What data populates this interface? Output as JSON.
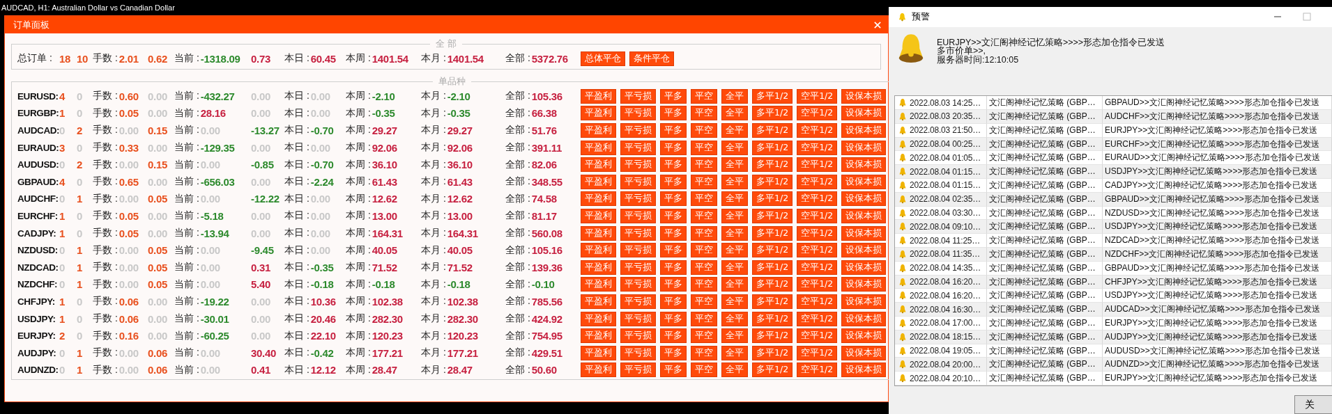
{
  "chart": {
    "title": "AUDCAD, H1:  Australian Dollar vs Canadian Dollar"
  },
  "order_panel": {
    "title": "订单面板",
    "summary": {
      "legend": "全 部",
      "label": "总订单 :",
      "cells": [
        {
          "text": "18",
          "color": "#e8501e"
        },
        {
          "text": "10",
          "color": "#e8501e"
        },
        {
          "label": "手数 :",
          "text": "2.01",
          "color": "#e8501e"
        },
        {
          "text": "0.62",
          "color": "#e8501e"
        },
        {
          "label": "当前 :",
          "text": "-1318.09",
          "color": "#2d8a2d"
        },
        {
          "text": "0.73",
          "color": "#c61f3f"
        },
        {
          "label": "本日 :",
          "text": "60.45",
          "color": "#c61f3f"
        },
        {
          "label": "本周 :",
          "text": "1401.54",
          "color": "#c61f3f"
        },
        {
          "label": "本月 :",
          "text": "1401.54",
          "color": "#c61f3f"
        },
        {
          "label": "全部 :",
          "text": "5372.76",
          "color": "#c61f3f"
        }
      ],
      "buttons": [
        "总体平仓",
        "条件平仓"
      ]
    },
    "symbols": {
      "legend": "单品种",
      "rows": [
        {
          "pair": "EURUSD:",
          "cells": [
            {
              "text": "4",
              "color": "#e8501e"
            },
            {
              "text": "0",
              "color": "#c8c8c8"
            },
            {
              "label": "手数 :",
              "text": "0.60",
              "color": "#e8501e"
            },
            {
              "text": "0.00",
              "color": "#c8c8c8"
            },
            {
              "label": "当前 :",
              "text": "-432.27",
              "color": "#2d8a2d"
            },
            {
              "text": "0.00",
              "color": "#c8c8c8"
            },
            {
              "label": "本日 :",
              "text": "0.00",
              "color": "#c8c8c8"
            },
            {
              "label": "本周 :",
              "text": "-2.10",
              "color": "#2d8a2d"
            },
            {
              "label": "本月 :",
              "text": "-2.10",
              "color": "#2d8a2d"
            },
            {
              "label": "全部 :",
              "text": "105.36",
              "color": "#c61f3f"
            }
          ],
          "buttons": [
            "平盈利",
            "平亏损",
            "平多",
            "平空",
            "全平",
            "多平1/2",
            "空平1/2",
            "设保本损"
          ]
        },
        {
          "pair": "EURGBP:",
          "cells": [
            {
              "text": "1",
              "color": "#e8501e"
            },
            {
              "text": "0",
              "color": "#c8c8c8"
            },
            {
              "label": "手数 :",
              "text": "0.05",
              "color": "#e8501e"
            },
            {
              "text": "0.00",
              "color": "#c8c8c8"
            },
            {
              "label": "当前 :",
              "text": "28.16",
              "color": "#c61f3f"
            },
            {
              "text": "0.00",
              "color": "#c8c8c8"
            },
            {
              "label": "本日 :",
              "text": "0.00",
              "color": "#c8c8c8"
            },
            {
              "label": "本周 :",
              "text": "-0.35",
              "color": "#2d8a2d"
            },
            {
              "label": "本月 :",
              "text": "-0.35",
              "color": "#2d8a2d"
            },
            {
              "label": "全部 :",
              "text": "66.38",
              "color": "#c61f3f"
            }
          ],
          "buttons": [
            "平盈利",
            "平亏损",
            "平多",
            "平空",
            "全平",
            "多平1/2",
            "空平1/2",
            "设保本损"
          ]
        },
        {
          "pair": "AUDCAD:",
          "cells": [
            {
              "text": "0",
              "color": "#c8c8c8"
            },
            {
              "text": "2",
              "color": "#e8501e"
            },
            {
              "label": "手数 :",
              "text": "0.00",
              "color": "#c8c8c8"
            },
            {
              "text": "0.15",
              "color": "#e8501e"
            },
            {
              "label": "当前 :",
              "text": "0.00",
              "color": "#c8c8c8"
            },
            {
              "text": "-13.27",
              "color": "#2d8a2d"
            },
            {
              "label": "本日 :",
              "text": "-0.70",
              "color": "#2d8a2d"
            },
            {
              "label": "本周 :",
              "text": "29.27",
              "color": "#c61f3f"
            },
            {
              "label": "本月 :",
              "text": "29.27",
              "color": "#c61f3f"
            },
            {
              "label": "全部 :",
              "text": "51.76",
              "color": "#c61f3f"
            }
          ],
          "buttons": [
            "平盈利",
            "平亏损",
            "平多",
            "平空",
            "全平",
            "多平1/2",
            "空平1/2",
            "设保本损"
          ]
        },
        {
          "pair": "EURAUD:",
          "cells": [
            {
              "text": "3",
              "color": "#e8501e"
            },
            {
              "text": "0",
              "color": "#c8c8c8"
            },
            {
              "label": "手数 :",
              "text": "0.33",
              "color": "#e8501e"
            },
            {
              "text": "0.00",
              "color": "#c8c8c8"
            },
            {
              "label": "当前 :",
              "text": "-129.35",
              "color": "#2d8a2d"
            },
            {
              "text": "0.00",
              "color": "#c8c8c8"
            },
            {
              "label": "本日 :",
              "text": "0.00",
              "color": "#c8c8c8"
            },
            {
              "label": "本周 :",
              "text": "92.06",
              "color": "#c61f3f"
            },
            {
              "label": "本月 :",
              "text": "92.06",
              "color": "#c61f3f"
            },
            {
              "label": "全部 :",
              "text": "391.11",
              "color": "#c61f3f"
            }
          ],
          "buttons": [
            "平盈利",
            "平亏损",
            "平多",
            "平空",
            "全平",
            "多平1/2",
            "空平1/2",
            "设保本损"
          ]
        },
        {
          "pair": "AUDUSD:",
          "cells": [
            {
              "text": "0",
              "color": "#c8c8c8"
            },
            {
              "text": "2",
              "color": "#e8501e"
            },
            {
              "label": "手数 :",
              "text": "0.00",
              "color": "#c8c8c8"
            },
            {
              "text": "0.15",
              "color": "#e8501e"
            },
            {
              "label": "当前 :",
              "text": "0.00",
              "color": "#c8c8c8"
            },
            {
              "text": "-0.85",
              "color": "#2d8a2d"
            },
            {
              "label": "本日 :",
              "text": "-0.70",
              "color": "#2d8a2d"
            },
            {
              "label": "本周 :",
              "text": "36.10",
              "color": "#c61f3f"
            },
            {
              "label": "本月 :",
              "text": "36.10",
              "color": "#c61f3f"
            },
            {
              "label": "全部 :",
              "text": "82.06",
              "color": "#c61f3f"
            }
          ],
          "buttons": [
            "平盈利",
            "平亏损",
            "平多",
            "平空",
            "全平",
            "多平1/2",
            "空平1/2",
            "设保本损"
          ]
        },
        {
          "pair": "GBPAUD:",
          "cells": [
            {
              "text": "4",
              "color": "#e8501e"
            },
            {
              "text": "0",
              "color": "#c8c8c8"
            },
            {
              "label": "手数 :",
              "text": "0.65",
              "color": "#e8501e"
            },
            {
              "text": "0.00",
              "color": "#c8c8c8"
            },
            {
              "label": "当前 :",
              "text": "-656.03",
              "color": "#2d8a2d"
            },
            {
              "text": "0.00",
              "color": "#c8c8c8"
            },
            {
              "label": "本日 :",
              "text": "-2.24",
              "color": "#2d8a2d"
            },
            {
              "label": "本周 :",
              "text": "61.43",
              "color": "#c61f3f"
            },
            {
              "label": "本月 :",
              "text": "61.43",
              "color": "#c61f3f"
            },
            {
              "label": "全部 :",
              "text": "348.55",
              "color": "#c61f3f"
            }
          ],
          "buttons": [
            "平盈利",
            "平亏损",
            "平多",
            "平空",
            "全平",
            "多平1/2",
            "空平1/2",
            "设保本损"
          ]
        },
        {
          "pair": "AUDCHF:",
          "cells": [
            {
              "text": "0",
              "color": "#c8c8c8"
            },
            {
              "text": "1",
              "color": "#e8501e"
            },
            {
              "label": "手数 :",
              "text": "0.00",
              "color": "#c8c8c8"
            },
            {
              "text": "0.05",
              "color": "#e8501e"
            },
            {
              "label": "当前 :",
              "text": "0.00",
              "color": "#c8c8c8"
            },
            {
              "text": "-12.22",
              "color": "#2d8a2d"
            },
            {
              "label": "本日 :",
              "text": "0.00",
              "color": "#c8c8c8"
            },
            {
              "label": "本周 :",
              "text": "12.62",
              "color": "#c61f3f"
            },
            {
              "label": "本月 :",
              "text": "12.62",
              "color": "#c61f3f"
            },
            {
              "label": "全部 :",
              "text": "74.58",
              "color": "#c61f3f"
            }
          ],
          "buttons": [
            "平盈利",
            "平亏损",
            "平多",
            "平空",
            "全平",
            "多平1/2",
            "空平1/2",
            "设保本损"
          ]
        },
        {
          "pair": "EURCHF:",
          "cells": [
            {
              "text": "1",
              "color": "#e8501e"
            },
            {
              "text": "0",
              "color": "#c8c8c8"
            },
            {
              "label": "手数 :",
              "text": "0.05",
              "color": "#e8501e"
            },
            {
              "text": "0.00",
              "color": "#c8c8c8"
            },
            {
              "label": "当前 :",
              "text": "-5.18",
              "color": "#2d8a2d"
            },
            {
              "text": "0.00",
              "color": "#c8c8c8"
            },
            {
              "label": "本日 :",
              "text": "0.00",
              "color": "#c8c8c8"
            },
            {
              "label": "本周 :",
              "text": "13.00",
              "color": "#c61f3f"
            },
            {
              "label": "本月 :",
              "text": "13.00",
              "color": "#c61f3f"
            },
            {
              "label": "全部 :",
              "text": "81.17",
              "color": "#c61f3f"
            }
          ],
          "buttons": [
            "平盈利",
            "平亏损",
            "平多",
            "平空",
            "全平",
            "多平1/2",
            "空平1/2",
            "设保本损"
          ]
        },
        {
          "pair": "CADJPY:",
          "cells": [
            {
              "text": "1",
              "color": "#e8501e"
            },
            {
              "text": "0",
              "color": "#c8c8c8"
            },
            {
              "label": "手数 :",
              "text": "0.05",
              "color": "#e8501e"
            },
            {
              "text": "0.00",
              "color": "#c8c8c8"
            },
            {
              "label": "当前 :",
              "text": "-13.94",
              "color": "#2d8a2d"
            },
            {
              "text": "0.00",
              "color": "#c8c8c8"
            },
            {
              "label": "本日 :",
              "text": "0.00",
              "color": "#c8c8c8"
            },
            {
              "label": "本周 :",
              "text": "164.31",
              "color": "#c61f3f"
            },
            {
              "label": "本月 :",
              "text": "164.31",
              "color": "#c61f3f"
            },
            {
              "label": "全部 :",
              "text": "560.08",
              "color": "#c61f3f"
            }
          ],
          "buttons": [
            "平盈利",
            "平亏损",
            "平多",
            "平空",
            "全平",
            "多平1/2",
            "空平1/2",
            "设保本损"
          ]
        },
        {
          "pair": "NZDUSD:",
          "cells": [
            {
              "text": "0",
              "color": "#c8c8c8"
            },
            {
              "text": "1",
              "color": "#e8501e"
            },
            {
              "label": "手数 :",
              "text": "0.00",
              "color": "#c8c8c8"
            },
            {
              "text": "0.05",
              "color": "#e8501e"
            },
            {
              "label": "当前 :",
              "text": "0.00",
              "color": "#c8c8c8"
            },
            {
              "text": "-9.45",
              "color": "#2d8a2d"
            },
            {
              "label": "本日 :",
              "text": "0.00",
              "color": "#c8c8c8"
            },
            {
              "label": "本周 :",
              "text": "40.05",
              "color": "#c61f3f"
            },
            {
              "label": "本月 :",
              "text": "40.05",
              "color": "#c61f3f"
            },
            {
              "label": "全部 :",
              "text": "105.16",
              "color": "#c61f3f"
            }
          ],
          "buttons": [
            "平盈利",
            "平亏损",
            "平多",
            "平空",
            "全平",
            "多平1/2",
            "空平1/2",
            "设保本损"
          ]
        },
        {
          "pair": "NZDCAD:",
          "cells": [
            {
              "text": "0",
              "color": "#c8c8c8"
            },
            {
              "text": "1",
              "color": "#e8501e"
            },
            {
              "label": "手数 :",
              "text": "0.00",
              "color": "#c8c8c8"
            },
            {
              "text": "0.05",
              "color": "#e8501e"
            },
            {
              "label": "当前 :",
              "text": "0.00",
              "color": "#c8c8c8"
            },
            {
              "text": "0.31",
              "color": "#c61f3f"
            },
            {
              "label": "本日 :",
              "text": "-0.35",
              "color": "#2d8a2d"
            },
            {
              "label": "本周 :",
              "text": "71.52",
              "color": "#c61f3f"
            },
            {
              "label": "本月 :",
              "text": "71.52",
              "color": "#c61f3f"
            },
            {
              "label": "全部 :",
              "text": "139.36",
              "color": "#c61f3f"
            }
          ],
          "buttons": [
            "平盈利",
            "平亏损",
            "平多",
            "平空",
            "全平",
            "多平1/2",
            "空平1/2",
            "设保本损"
          ]
        },
        {
          "pair": "NZDCHF:",
          "cells": [
            {
              "text": "0",
              "color": "#c8c8c8"
            },
            {
              "text": "1",
              "color": "#e8501e"
            },
            {
              "label": "手数 :",
              "text": "0.00",
              "color": "#c8c8c8"
            },
            {
              "text": "0.05",
              "color": "#e8501e"
            },
            {
              "label": "当前 :",
              "text": "0.00",
              "color": "#c8c8c8"
            },
            {
              "text": "5.40",
              "color": "#c61f3f"
            },
            {
              "label": "本日 :",
              "text": "-0.18",
              "color": "#2d8a2d"
            },
            {
              "label": "本周 :",
              "text": "-0.18",
              "color": "#2d8a2d"
            },
            {
              "label": "本月 :",
              "text": "-0.18",
              "color": "#2d8a2d"
            },
            {
              "label": "全部 :",
              "text": "-0.10",
              "color": "#2d8a2d"
            }
          ],
          "buttons": [
            "平盈利",
            "平亏损",
            "平多",
            "平空",
            "全平",
            "多平1/2",
            "空平1/2",
            "设保本损"
          ]
        },
        {
          "pair": "CHFJPY:",
          "cells": [
            {
              "text": "1",
              "color": "#e8501e"
            },
            {
              "text": "0",
              "color": "#c8c8c8"
            },
            {
              "label": "手数 :",
              "text": "0.06",
              "color": "#e8501e"
            },
            {
              "text": "0.00",
              "color": "#c8c8c8"
            },
            {
              "label": "当前 :",
              "text": "-19.22",
              "color": "#2d8a2d"
            },
            {
              "text": "0.00",
              "color": "#c8c8c8"
            },
            {
              "label": "本日 :",
              "text": "10.36",
              "color": "#c61f3f"
            },
            {
              "label": "本周 :",
              "text": "102.38",
              "color": "#c61f3f"
            },
            {
              "label": "本月 :",
              "text": "102.38",
              "color": "#c61f3f"
            },
            {
              "label": "全部 :",
              "text": "785.56",
              "color": "#c61f3f"
            }
          ],
          "buttons": [
            "平盈利",
            "平亏损",
            "平多",
            "平空",
            "全平",
            "多平1/2",
            "空平1/2",
            "设保本损"
          ]
        },
        {
          "pair": "USDJPY:",
          "cells": [
            {
              "text": "1",
              "color": "#e8501e"
            },
            {
              "text": "0",
              "color": "#c8c8c8"
            },
            {
              "label": "手数 :",
              "text": "0.06",
              "color": "#e8501e"
            },
            {
              "text": "0.00",
              "color": "#c8c8c8"
            },
            {
              "label": "当前 :",
              "text": "-30.01",
              "color": "#2d8a2d"
            },
            {
              "text": "0.00",
              "color": "#c8c8c8"
            },
            {
              "label": "本日 :",
              "text": "20.46",
              "color": "#c61f3f"
            },
            {
              "label": "本周 :",
              "text": "282.30",
              "color": "#c61f3f"
            },
            {
              "label": "本月 :",
              "text": "282.30",
              "color": "#c61f3f"
            },
            {
              "label": "全部 :",
              "text": "424.92",
              "color": "#c61f3f"
            }
          ],
          "buttons": [
            "平盈利",
            "平亏损",
            "平多",
            "平空",
            "全平",
            "多平1/2",
            "空平1/2",
            "设保本损"
          ]
        },
        {
          "pair": "EURJPY:",
          "cells": [
            {
              "text": "2",
              "color": "#e8501e"
            },
            {
              "text": "0",
              "color": "#c8c8c8"
            },
            {
              "label": "手数 :",
              "text": "0.16",
              "color": "#e8501e"
            },
            {
              "text": "0.00",
              "color": "#c8c8c8"
            },
            {
              "label": "当前 :",
              "text": "-60.25",
              "color": "#2d8a2d"
            },
            {
              "text": "0.00",
              "color": "#c8c8c8"
            },
            {
              "label": "本日 :",
              "text": "22.10",
              "color": "#c61f3f"
            },
            {
              "label": "本周 :",
              "text": "120.23",
              "color": "#c61f3f"
            },
            {
              "label": "本月 :",
              "text": "120.23",
              "color": "#c61f3f"
            },
            {
              "label": "全部 :",
              "text": "754.95",
              "color": "#c61f3f"
            }
          ],
          "buttons": [
            "平盈利",
            "平亏损",
            "平多",
            "平空",
            "全平",
            "多平1/2",
            "空平1/2",
            "设保本损"
          ]
        },
        {
          "pair": "AUDJPY:",
          "cells": [
            {
              "text": "0",
              "color": "#c8c8c8"
            },
            {
              "text": "1",
              "color": "#e8501e"
            },
            {
              "label": "手数 :",
              "text": "0.00",
              "color": "#c8c8c8"
            },
            {
              "text": "0.06",
              "color": "#e8501e"
            },
            {
              "label": "当前 :",
              "text": "0.00",
              "color": "#c8c8c8"
            },
            {
              "text": "30.40",
              "color": "#c61f3f"
            },
            {
              "label": "本日 :",
              "text": "-0.42",
              "color": "#2d8a2d"
            },
            {
              "label": "本周 :",
              "text": "177.21",
              "color": "#c61f3f"
            },
            {
              "label": "本月 :",
              "text": "177.21",
              "color": "#c61f3f"
            },
            {
              "label": "全部 :",
              "text": "429.51",
              "color": "#c61f3f"
            }
          ],
          "buttons": [
            "平盈利",
            "平亏损",
            "平多",
            "平空",
            "全平",
            "多平1/2",
            "空平1/2",
            "设保本损"
          ]
        },
        {
          "pair": "AUDNZD:",
          "cells": [
            {
              "text": "0",
              "color": "#c8c8c8"
            },
            {
              "text": "1",
              "color": "#e8501e"
            },
            {
              "label": "手数 :",
              "text": "0.00",
              "color": "#c8c8c8"
            },
            {
              "text": "0.06",
              "color": "#e8501e"
            },
            {
              "label": "当前 :",
              "text": "0.00",
              "color": "#c8c8c8"
            },
            {
              "text": "0.41",
              "color": "#c61f3f"
            },
            {
              "label": "本日 :",
              "text": "12.12",
              "color": "#c61f3f"
            },
            {
              "label": "本周 :",
              "text": "28.47",
              "color": "#c61f3f"
            },
            {
              "label": "本月 :",
              "text": "28.47",
              "color": "#c61f3f"
            },
            {
              "label": "全部 :",
              "text": "50.60",
              "color": "#c61f3f"
            }
          ],
          "buttons": [
            "平盈利",
            "平亏损",
            "平多",
            "平空",
            "全平",
            "多平1/2",
            "空平1/2",
            "设保本损"
          ]
        }
      ]
    }
  },
  "alert_window": {
    "title": "预警",
    "message": [
      "EURJPY>>文汇阁神经记忆策略>>>>形态加仓指令已发送",
      "多市价单>>,",
      "服务器时间:12:10:05"
    ],
    "rows": [
      {
        "time": "2022.08.03 14:25…",
        "source": "文汇阁神经记忆策略 (GBP…",
        "message": "GBPAUD>>文汇阁神经记忆策略>>>>形态加仓指令已发送"
      },
      {
        "time": "2022.08.03 20:35…",
        "source": "文汇阁神经记忆策略 (GBP…",
        "message": "AUDCHF>>文汇阁神经记忆策略>>>>形态加仓指令已发送"
      },
      {
        "time": "2022.08.03 21:50…",
        "source": "文汇阁神经记忆策略 (GBP…",
        "message": "EURJPY>>文汇阁神经记忆策略>>>>形态加仓指令已发送"
      },
      {
        "time": "2022.08.04 00:25…",
        "source": "文汇阁神经记忆策略 (GBP…",
        "message": "EURCHF>>文汇阁神经记忆策略>>>>形态加仓指令已发送"
      },
      {
        "time": "2022.08.04 01:05…",
        "source": "文汇阁神经记忆策略 (GBP…",
        "message": "EURAUD>>文汇阁神经记忆策略>>>>形态加仓指令已发送"
      },
      {
        "time": "2022.08.04 01:15…",
        "source": "文汇阁神经记忆策略 (GBP…",
        "message": "USDJPY>>文汇阁神经记忆策略>>>>形态加仓指令已发送"
      },
      {
        "time": "2022.08.04 01:15…",
        "source": "文汇阁神经记忆策略 (GBP…",
        "message": "CADJPY>>文汇阁神经记忆策略>>>>形态加仓指令已发送"
      },
      {
        "time": "2022.08.04 02:35…",
        "source": "文汇阁神经记忆策略 (GBP…",
        "message": "GBPAUD>>文汇阁神经记忆策略>>>>形态加仓指令已发送"
      },
      {
        "time": "2022.08.04 03:30…",
        "source": "文汇阁神经记忆策略 (GBP…",
        "message": "NZDUSD>>文汇阁神经记忆策略>>>>形态加仓指令已发送"
      },
      {
        "time": "2022.08.04 09:10…",
        "source": "文汇阁神经记忆策略 (GBP…",
        "message": "USDJPY>>文汇阁神经记忆策略>>>>形态加仓指令已发送"
      },
      {
        "time": "2022.08.04 11:25…",
        "source": "文汇阁神经记忆策略 (GBP…",
        "message": "NZDCAD>>文汇阁神经记忆策略>>>>形态加仓指令已发送"
      },
      {
        "time": "2022.08.04 11:35…",
        "source": "文汇阁神经记忆策略 (GBP…",
        "message": "NZDCHF>>文汇阁神经记忆策略>>>>形态加仓指令已发送"
      },
      {
        "time": "2022.08.04 14:35…",
        "source": "文汇阁神经记忆策略 (GBP…",
        "message": "GBPAUD>>文汇阁神经记忆策略>>>>形态加仓指令已发送"
      },
      {
        "time": "2022.08.04 16:20…",
        "source": "文汇阁神经记忆策略 (GBP…",
        "message": "CHFJPY>>文汇阁神经记忆策略>>>>形态加仓指令已发送"
      },
      {
        "time": "2022.08.04 16:20…",
        "source": "文汇阁神经记忆策略 (GBP…",
        "message": "USDJPY>>文汇阁神经记忆策略>>>>形态加仓指令已发送"
      },
      {
        "time": "2022.08.04 16:30…",
        "source": "文汇阁神经记忆策略 (GBP…",
        "message": "AUDCAD>>文汇阁神经记忆策略>>>>形态加仓指令已发送"
      },
      {
        "time": "2022.08.04 17:00…",
        "source": "文汇阁神经记忆策略 (GBP…",
        "message": "EURJPY>>文汇阁神经记忆策略>>>>形态加仓指令已发送"
      },
      {
        "time": "2022.08.04 18:15…",
        "source": "文汇阁神经记忆策略 (GBP…",
        "message": "AUDJPY>>文汇阁神经记忆策略>>>>形态加仓指令已发送"
      },
      {
        "time": "2022.08.04 19:05…",
        "source": "文汇阁神经记忆策略 (GBP…",
        "message": "AUDUSD>>文汇阁神经记忆策略>>>>形态加仓指令已发送"
      },
      {
        "time": "2022.08.04 20:00…",
        "source": "文汇阁神经记忆策略 (GBP…",
        "message": "AUDNZD>>文汇阁神经记忆策略>>>>形态加仓指令已发送"
      },
      {
        "time": "2022.08.04 20:10…",
        "source": "文汇阁神经记忆策略 (GBP…",
        "message": "EURJPY>>文汇阁神经记忆策略>>>>形态加仓指令已发送"
      }
    ],
    "close_button": "关"
  }
}
